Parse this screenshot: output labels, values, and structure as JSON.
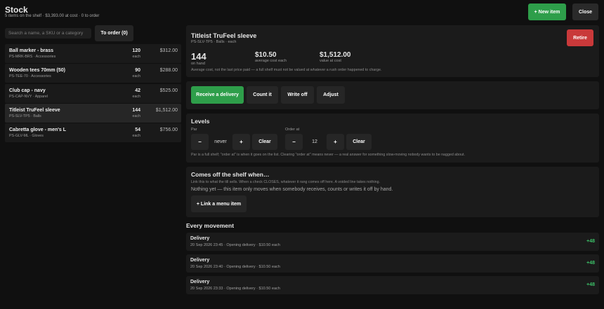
{
  "header": {
    "title": "Stock",
    "subtitle": "5 items on the shelf · $3,393.00 at cost · 0 to order",
    "new_item_label": "+ New item",
    "close_label": "Close"
  },
  "search": {
    "placeholder": "Search a name, a SKU or a category",
    "value": ""
  },
  "to_order_label": "To order (0)",
  "items": [
    {
      "name": "Ball marker - brass",
      "meta": "PS-MRK-BRS · Accessories",
      "qty": "120",
      "unit": "each",
      "value": "$312.00"
    },
    {
      "name": "Wooden tees 70mm (50)",
      "meta": "PS-TEE-70 · Accessories",
      "qty": "90",
      "unit": "each",
      "value": "$288.00"
    },
    {
      "name": "Club cap - navy",
      "meta": "PS-CAP-NVY · Apparel",
      "qty": "42",
      "unit": "each",
      "value": "$525.00"
    },
    {
      "name": "Titleist TruFeel sleeve",
      "meta": "PS-SLV-TP5 · Balls",
      "qty": "144",
      "unit": "each",
      "value": "$1,512.00"
    },
    {
      "name": "Cabretta glove - men's L",
      "meta": "PS-GLV-ML · Gloves",
      "qty": "54",
      "unit": "each",
      "value": "$756.00"
    }
  ],
  "detail": {
    "title": "Titleist TruFeel sleeve",
    "subtitle": "PS-SLV-TP5 · Balls · each",
    "retire_label": "Retire",
    "on_hand_value": "144",
    "on_hand_label": "on hand",
    "avg_cost_value": "$10.50",
    "avg_cost_label": "average cost each",
    "value_at_cost": "$1,512.00",
    "value_label": "value at cost",
    "note": "Average cost, not the last price paid — a full shelf must not be valued at whatever a rush order happened to charge."
  },
  "actions": {
    "receive": "Receive a delivery",
    "count": "Count it",
    "write_off": "Write off",
    "adjust": "Adjust"
  },
  "levels": {
    "title": "Levels",
    "par_label": "Par",
    "par_minus": "−",
    "par_value": "never",
    "par_plus": "+",
    "par_clear": "Clear",
    "order_label": "Order at",
    "order_minus": "−",
    "order_value": "12",
    "order_plus": "+",
    "order_clear": "Clear",
    "note": "Par is a full shelf; \"order at\" is when it goes on the list. Clearing \"order at\" means never — a real answer for something slow-moving nobody wants to be nagged about."
  },
  "shelf": {
    "title": "Comes off the shelf when…",
    "note": "Link this to what the till sells. When a check CLOSES, whatever it rang comes off here. A voided line takes nothing.",
    "empty": "Nothing yet — this item only moves when somebody receives, counts or writes it off by hand.",
    "link_label": "+ Link a menu item"
  },
  "movement": {
    "title": "Every movement",
    "rows": [
      {
        "type": "Delivery",
        "meta": "20 Sep 2026 23:45 · Opening delivery · $10.50 each",
        "qty": "+48"
      },
      {
        "type": "Delivery",
        "meta": "20 Sep 2026 23:40 · Opening delivery · $10.50 each",
        "qty": "+48"
      },
      {
        "type": "Delivery",
        "meta": "20 Sep 2026 23:33 · Opening delivery · $10.50 each",
        "qty": "+48"
      }
    ]
  },
  "colors": {
    "accent_green": "#2e9e4a",
    "danger_red": "#c9393a",
    "positive_text": "#3cc168"
  }
}
